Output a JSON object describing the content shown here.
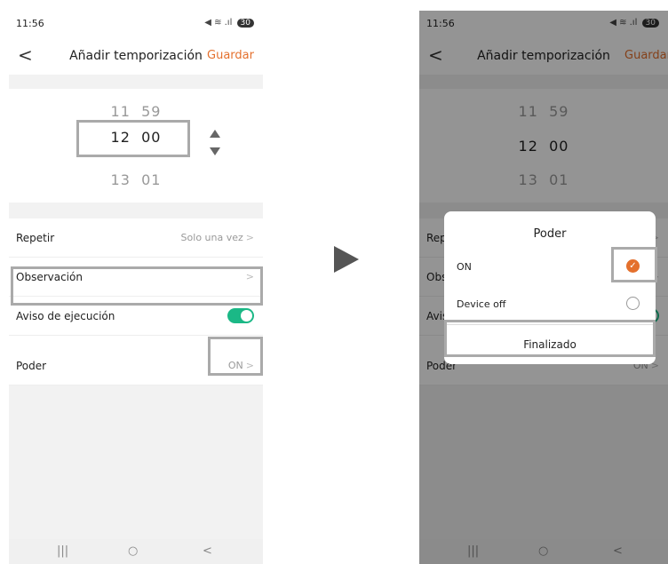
{
  "status": {
    "time": "11:56",
    "battery": "30"
  },
  "nav": {
    "back": "<",
    "title": "Añadir temporización",
    "save": "Guardar"
  },
  "picker": {
    "prev_hour": "11",
    "prev_min": "59",
    "sel_hour": "12",
    "sel_min": "00",
    "next_hour": "13",
    "next_min": "01"
  },
  "settings": {
    "repeat_label": "Repetir",
    "repeat_value": "Solo una vez",
    "note_label": "Observación",
    "notice_label": "Aviso de ejecución",
    "notice_on": true,
    "power_label": "Poder",
    "power_value": "ON"
  },
  "dialog": {
    "title": "Poder",
    "opt_on": "ON",
    "opt_off": "Device off",
    "selected": "ON",
    "done": "Finalizado"
  },
  "bottom_nav": {
    "recents": "|||",
    "home": "○",
    "back": "<"
  },
  "colors": {
    "accent": "#e4702d",
    "toggle": "#1bb886"
  }
}
